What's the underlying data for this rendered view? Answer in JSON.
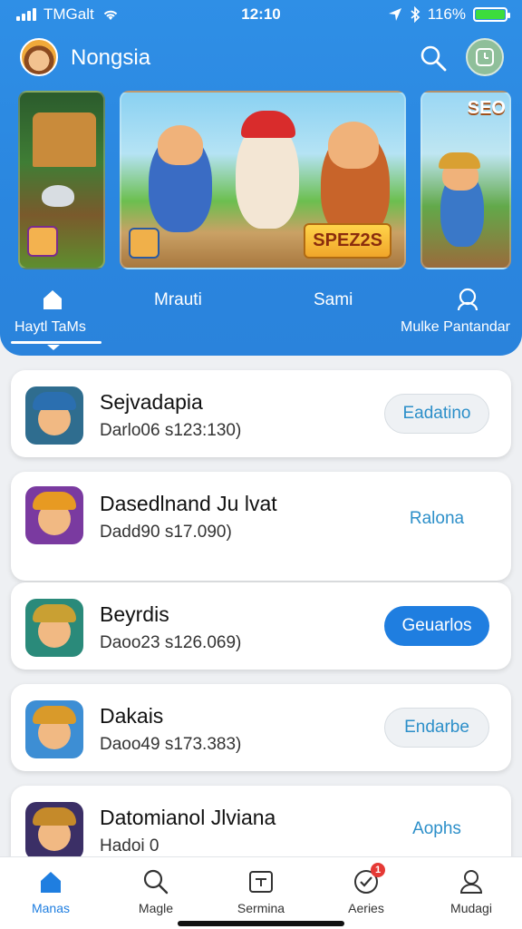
{
  "status_bar": {
    "carrier": "TMGalt",
    "time": "12:10",
    "battery_text": "116%"
  },
  "app_bar": {
    "title": "Nongsia"
  },
  "banners": {
    "main_badge": "SPEZ2S",
    "side_tag": "SEO"
  },
  "header_tabs": [
    {
      "label": "Haytl TaMs",
      "icon": "home-icon",
      "active": true
    },
    {
      "label": "Mrauti"
    },
    {
      "label": "Sami"
    },
    {
      "label": "Mulke Pantandar",
      "icon": "user-icon"
    }
  ],
  "games": [
    {
      "title": "Sejvadapia",
      "sub": "Darlo06 s123:130)",
      "action": "Eadatino",
      "style": "ghost",
      "thumb_bg": "#2f6d8f",
      "hat": "#2b6fb0"
    },
    {
      "title": "Dasedlnand Ju lvat",
      "sub": "Dadd90 s17.090)",
      "action": "Ralona",
      "style": "text",
      "thumb_bg": "#7a3aa0",
      "hat": "#e79a22"
    },
    {
      "title": "Beyrdis",
      "sub": "Daoo23 s126.069)",
      "action": "Geuarlos",
      "style": "primary",
      "thumb_bg": "#2a8a7a",
      "hat": "#c9a033"
    },
    {
      "title": "Dakais",
      "sub": "Daoo49 s173.383)",
      "action": "Endarbe",
      "style": "ghost",
      "thumb_bg": "#3d8ed4",
      "hat": "#d99a2a"
    },
    {
      "title": "Datomianol Jlviana",
      "sub": "Hadoi 0",
      "action": "Aophs",
      "style": "text",
      "thumb_bg": "#3b2f66",
      "hat": "#c58a2a"
    }
  ],
  "bottom_nav": [
    {
      "label": "Manas",
      "icon": "home-icon",
      "active": true
    },
    {
      "label": "Magle",
      "icon": "search-icon"
    },
    {
      "label": "Sermina",
      "icon": "calendar-icon"
    },
    {
      "label": "Aeries",
      "icon": "check-badge-icon",
      "badge": "1"
    },
    {
      "label": "Mudagi",
      "icon": "user-icon"
    }
  ],
  "colors": {
    "header_blue": "#2a86df",
    "accent": "#1f7ee0",
    "link": "#2c8fc9"
  }
}
